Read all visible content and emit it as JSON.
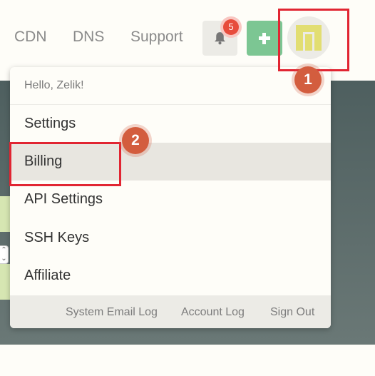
{
  "nav": {
    "links": [
      "CDN",
      "DNS",
      "Support"
    ],
    "notification_count": "5"
  },
  "dropdown": {
    "greeting": "Hello, Zelik!",
    "items": [
      "Settings",
      "Billing",
      "API Settings",
      "SSH Keys",
      "Affiliate"
    ],
    "active_item": "Billing",
    "footer_links": [
      "System Email Log",
      "Account Log",
      "Sign Out"
    ]
  },
  "annotations": [
    "1",
    "2"
  ],
  "icons": {
    "bell": "bell-icon",
    "add": "plus-icon",
    "avatar": "identicon-avatar"
  },
  "colors": {
    "badge": "#e74c3c",
    "add_button": "#7cc693",
    "annotation_box": "#e12532",
    "annotation_marker": "#d35d3e",
    "avatar_pattern": "#e2de72"
  }
}
